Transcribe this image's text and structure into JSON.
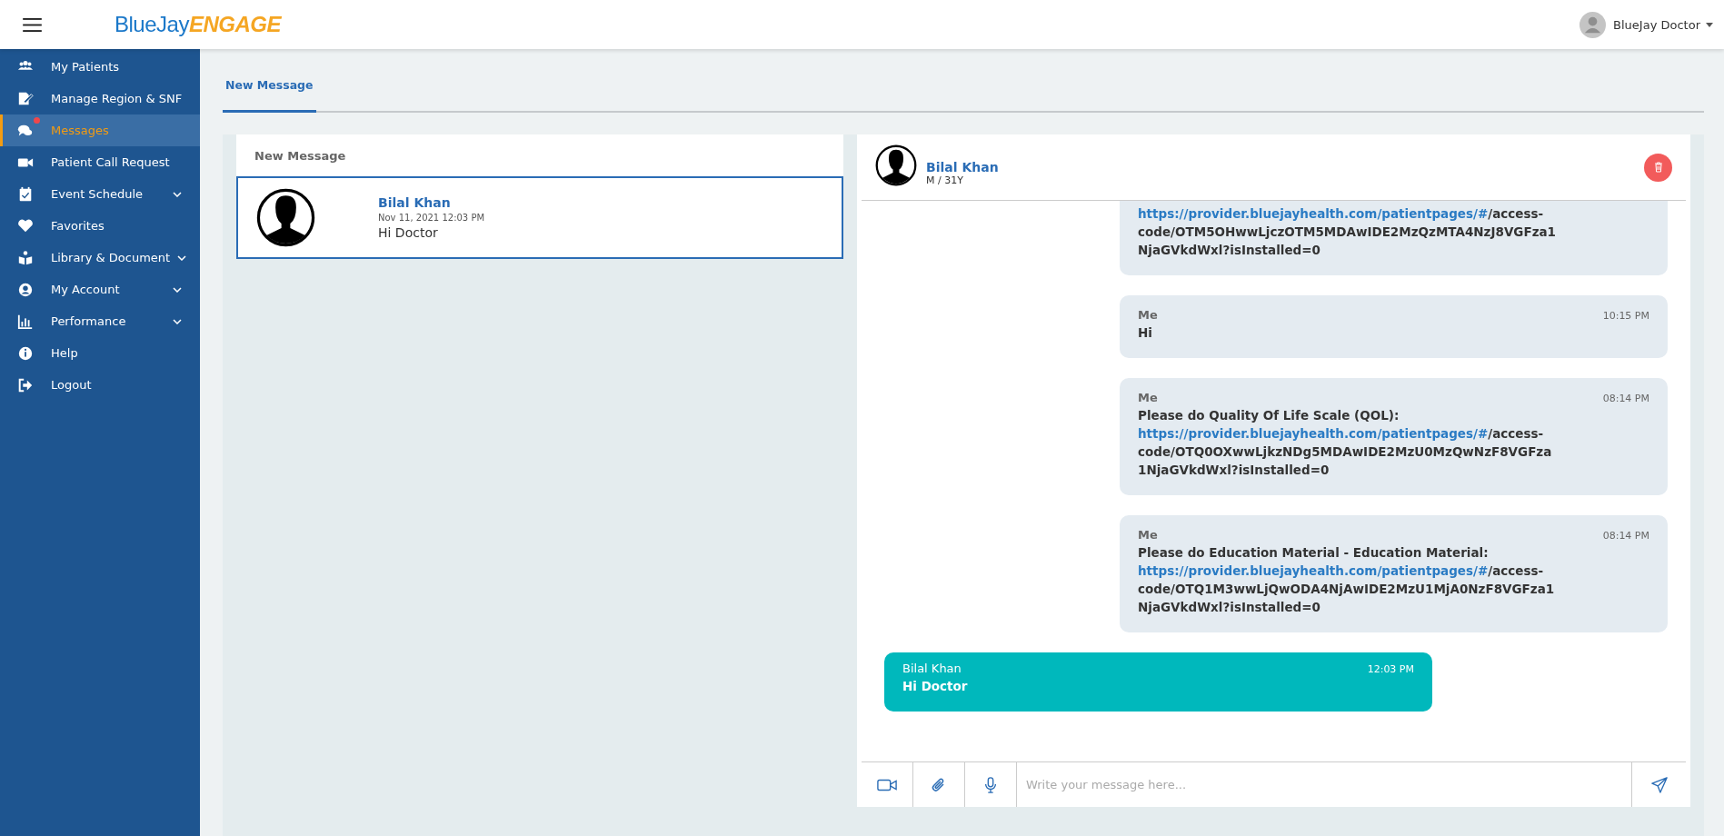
{
  "header": {
    "logo": {
      "part_1": "BlueJay",
      "part_2": "ENGAGE"
    },
    "user": "BlueJay Doctor"
  },
  "sidebar": {
    "items": [
      {
        "label": "My Patients",
        "selected": false,
        "expandable": false,
        "unread": false
      },
      {
        "label": "Manage Region & SNF",
        "selected": false,
        "expandable": false,
        "unread": false
      },
      {
        "label": "Messages",
        "selected": true,
        "expandable": false,
        "unread": true
      },
      {
        "label": "Patient Call Request",
        "selected": false,
        "expandable": false,
        "unread": false
      },
      {
        "label": "Event Schedule",
        "selected": false,
        "expandable": true,
        "unread": false
      },
      {
        "label": "Favorites",
        "selected": false,
        "expandable": false,
        "unread": false
      },
      {
        "label": "Library & Document",
        "selected": false,
        "expandable": true,
        "unread": false
      },
      {
        "label": "My Account",
        "selected": false,
        "expandable": true,
        "unread": false
      },
      {
        "label": "Performance",
        "selected": false,
        "expandable": true,
        "unread": false
      },
      {
        "label": "Help",
        "selected": false,
        "expandable": false,
        "unread": false
      },
      {
        "label": "Logout",
        "selected": false,
        "expandable": false,
        "unread": false
      }
    ]
  },
  "tabs": [
    {
      "label": "New Message",
      "selected": true
    }
  ],
  "conversation_list": {
    "title": "New Message",
    "items": [
      {
        "name": "Bilal Khan",
        "time": "Nov 11, 2021 12:03 PM",
        "preview": "Hi Doctor",
        "selected": true
      }
    ]
  },
  "chat": {
    "name": "Bilal Khan",
    "details": "M / 31Y",
    "messages": [
      {
        "kind": "sent",
        "lines": [
          [
            {
              "kind": "link",
              "text": "https://provider.bluejayhealth.com/patientpages/#"
            },
            {
              "kind": "text",
              "text": "/access-"
            }
          ],
          [
            {
              "kind": "text",
              "text": "code/OTM5OHwwLjczOTM5MDAwIDE2MzQzMTA4NzJ8VGFza1"
            }
          ],
          [
            {
              "kind": "text",
              "text": "NjaGVkdWxl?isInstalled=0"
            }
          ]
        ]
      },
      {
        "kind": "sent",
        "sender": "Me",
        "time": "10:15 PM",
        "lines": [
          [
            {
              "kind": "text",
              "text": "Hi"
            }
          ]
        ]
      },
      {
        "kind": "sent",
        "sender": "Me",
        "time": "08:14 PM",
        "lines": [
          [
            {
              "kind": "text",
              "text": "Please do Quality Of Life Scale (QOL):"
            }
          ],
          [
            {
              "kind": "link",
              "text": "https://provider.bluejayhealth.com/patientpages/#"
            },
            {
              "kind": "text",
              "text": "/access-"
            }
          ],
          [
            {
              "kind": "text",
              "text": "code/OTQ0OXwwLjkzNDg5MDAwIDE2MzU0MzQwNzF8VGFza"
            }
          ],
          [
            {
              "kind": "text",
              "text": "1NjaGVkdWxl?isInstalled=0"
            }
          ]
        ]
      },
      {
        "kind": "sent",
        "sender": "Me",
        "time": "08:14 PM",
        "lines": [
          [
            {
              "kind": "text",
              "text": "Please do Education Material - Education Material:"
            }
          ],
          [
            {
              "kind": "link",
              "text": "https://provider.bluejayhealth.com/patientpages/#"
            },
            {
              "kind": "text",
              "text": "/access-"
            }
          ],
          [
            {
              "kind": "text",
              "text": "code/OTQ1M3wwLjQwODA4NjAwIDE2MzU1MjA0NzF8VGFza1"
            }
          ],
          [
            {
              "kind": "text",
              "text": "NjaGVkdWxl?isInstalled=0"
            }
          ]
        ]
      },
      {
        "kind": "received",
        "sender": "Bilal Khan",
        "time": "12:03 PM",
        "lines": [
          [
            {
              "kind": "text",
              "text": "Hi Doctor"
            }
          ]
        ]
      }
    ],
    "composer": {
      "placeholder": "Write your message here..."
    }
  }
}
